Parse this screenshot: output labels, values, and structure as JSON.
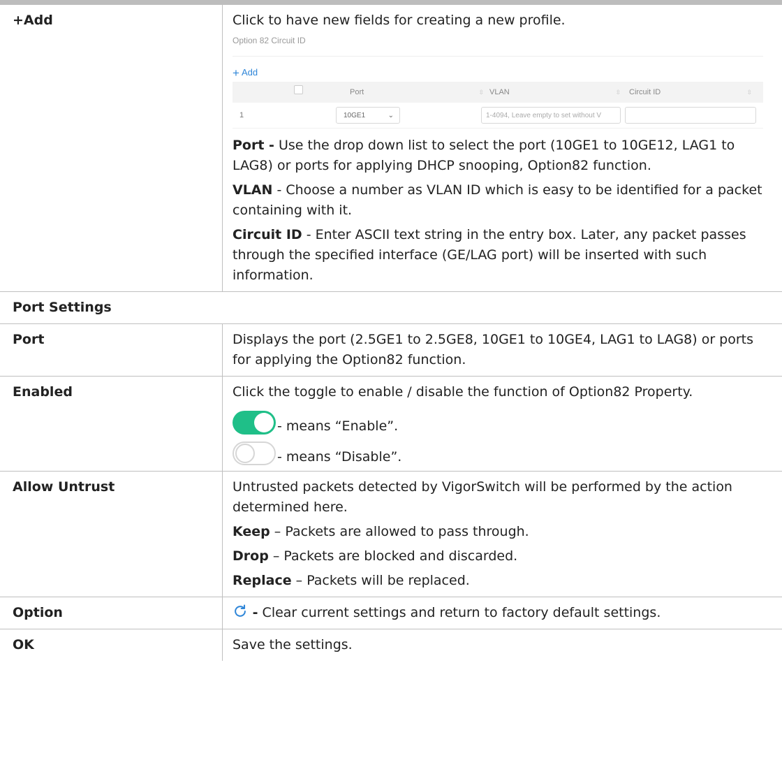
{
  "rows": {
    "add": {
      "label": "+Add",
      "intro": "Click to have new fields for creating a new profile.",
      "screenshot": {
        "title": "Option 82 Circuit ID",
        "add_label": "Add",
        "headers": [
          "Port",
          "VLAN",
          "Circuit ID"
        ],
        "row_index": "1",
        "port_value": "10GE1",
        "vlan_placeholder": "1-4094, Leave empty to set without V",
        "circuit_value": ""
      },
      "items": [
        {
          "term": "Port -",
          "text": " Use the drop down list to select the port (10GE1 to 10GE12, LAG1 to LAG8) or ports for applying DHCP snooping, Option82 function."
        },
        {
          "term": "VLAN",
          "text": " - Choose a number as VLAN ID which is easy to be identified for a packet containing with it."
        },
        {
          "term": "Circuit ID",
          "text": " - Enter ASCII text string in the entry box. Later, any packet passes through the specified interface (GE/LAG port) will be inserted with such information."
        }
      ]
    },
    "section": "Port Settings",
    "port": {
      "label": "Port",
      "text": "Displays the port (2.5GE1 to 2.5GE8, 10GE1 to 10GE4, LAG1 to LAG8) or ports for applying the Option82 function."
    },
    "enabled": {
      "label": "Enabled",
      "text": "Click the toggle to enable / disable the function of Option82 Property.",
      "on_text": "- means “Enable”.",
      "off_text": "- means “Disable”.",
      "on_color": "#1fbf88",
      "icons": [
        "toggle-on-icon",
        "toggle-off-icon"
      ]
    },
    "allow": {
      "label": "Allow Untrust",
      "text": "Untrusted packets detected by VigorSwitch will be performed by the action determined here.",
      "items": [
        {
          "term": "Keep",
          "text": " – Packets are allowed to pass through."
        },
        {
          "term": "Drop",
          "text": " – Packets are blocked and discarded."
        },
        {
          "term": "Replace",
          "text": " – Packets will be replaced."
        }
      ]
    },
    "option": {
      "label": "Option",
      "dash": " -",
      "text": " Clear current settings and return to factory default settings.",
      "icon": "refresh-icon",
      "icon_color": "#2f86d8"
    },
    "ok": {
      "label": "OK",
      "text": "Save the settings."
    }
  }
}
